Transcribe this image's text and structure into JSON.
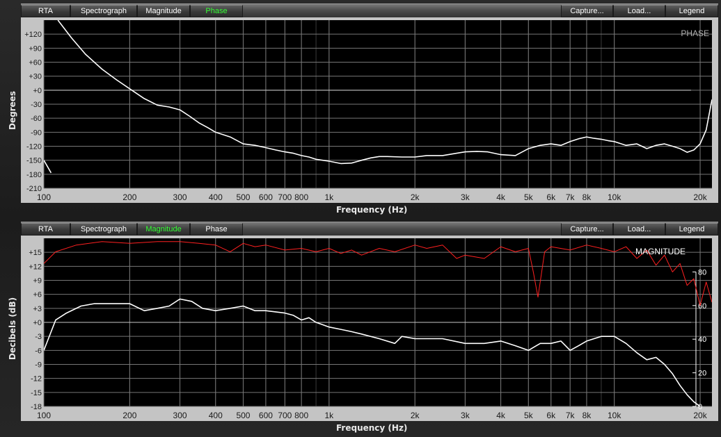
{
  "toolbar": {
    "tabs": [
      "RTA",
      "Spectrograph",
      "Magnitude",
      "Phase"
    ],
    "actions": [
      "Capture...",
      "Load...",
      "Legend"
    ]
  },
  "phase_panel": {
    "active_tab": "Phase"
  },
  "magnitude_panel": {
    "active_tab": "Magnitude"
  },
  "colors": {
    "trace": "#ffffff",
    "coherence": "#ff2020",
    "active_tab": "#33ff33",
    "plot_bg": "#000000"
  },
  "chart_data": [
    {
      "type": "line",
      "plot_label": "PHASE",
      "xlabel": "Frequency (Hz)",
      "ylabel": "Degrees",
      "xscale": "log",
      "xlim": [
        100,
        22000
      ],
      "ylim": [
        -210,
        150
      ],
      "x_ticks": [
        100,
        200,
        300,
        400,
        500,
        600,
        700,
        800,
        1000,
        2000,
        3000,
        4000,
        5000,
        6000,
        7000,
        8000,
        10000,
        20000
      ],
      "x_tick_labels": [
        "100",
        "200",
        "300",
        "400",
        "500",
        "600",
        "700",
        "800",
        "1k",
        "2k",
        "3k",
        "4k",
        "5k",
        "6k",
        "7k",
        "8k",
        "10k",
        "20k"
      ],
      "y_ticks": [
        120,
        90,
        60,
        30,
        0,
        -30,
        -60,
        -90,
        -120,
        -150,
        -180,
        -210
      ],
      "y_tick_labels": [
        "+120",
        "+90",
        "+60",
        "+30",
        "+0",
        "-30",
        "-60",
        "-90",
        "-120",
        "-150",
        "-180",
        "-210"
      ],
      "grid": true,
      "series": [
        {
          "x": [
            100,
            106
          ],
          "y": [
            -150,
            -177
          ]
        },
        {
          "x": [
            112,
            125,
            140,
            160,
            180,
            200,
            225,
            250,
            275,
            300,
            325,
            350,
            375,
            400,
            450,
            500,
            550,
            600,
            650,
            700,
            750,
            800,
            850,
            900,
            950,
            1000,
            1100,
            1200,
            1300,
            1400,
            1500,
            1600,
            1800,
            2000,
            2200,
            2500,
            2800,
            3000,
            3300,
            3600,
            4000,
            4500,
            5000,
            5500,
            6000,
            6500,
            7000,
            7500,
            8000,
            8500,
            9000,
            9500,
            10000,
            11000,
            12000,
            13000,
            14000,
            15000,
            16000,
            17000,
            18000,
            19000,
            20000,
            21000,
            22000
          ],
          "y": [
            150,
            112,
            77,
            45,
            22,
            3,
            -18,
            -32,
            -36,
            -42,
            -56,
            -70,
            -80,
            -90,
            -100,
            -115,
            -118,
            -123,
            -128,
            -132,
            -135,
            -140,
            -143,
            -148,
            -150,
            -152,
            -157,
            -156,
            -150,
            -145,
            -142,
            -142,
            -143,
            -143,
            -140,
            -140,
            -135,
            -132,
            -131,
            -132,
            -138,
            -140,
            -125,
            -118,
            -115,
            -118,
            -110,
            -104,
            -100,
            -103,
            -105,
            -108,
            -110,
            -118,
            -115,
            -125,
            -118,
            -115,
            -120,
            -125,
            -133,
            -128,
            -115,
            -85,
            -20
          ]
        }
      ]
    },
    {
      "type": "line",
      "plot_label": "MAGNITUDE",
      "xlabel": "Frequency (Hz)",
      "ylabel": "Decibels (dB)",
      "xscale": "log",
      "xlim": [
        100,
        22000
      ],
      "ylim": [
        -18,
        18
      ],
      "y2lim": [
        0,
        100
      ],
      "x_ticks": [
        100,
        200,
        300,
        400,
        500,
        600,
        700,
        800,
        1000,
        2000,
        3000,
        4000,
        5000,
        6000,
        7000,
        8000,
        10000,
        20000
      ],
      "x_tick_labels": [
        "100",
        "200",
        "300",
        "400",
        "500",
        "600",
        "700",
        "800",
        "1k",
        "2k",
        "3k",
        "4k",
        "5k",
        "6k",
        "7k",
        "8k",
        "10k",
        "20k"
      ],
      "y_ticks": [
        15,
        12,
        9,
        6,
        3,
        0,
        -3,
        -6,
        -9,
        -12,
        -15,
        -18
      ],
      "y_tick_labels": [
        "+15",
        "+12",
        "+9",
        "+6",
        "+3",
        "+0",
        "-3",
        "-6",
        "-9",
        "-12",
        "-15",
        "-18"
      ],
      "y2_ticks": [
        0,
        20,
        40,
        60,
        80
      ],
      "y2_tick_labels": [
        "0",
        "20",
        "40",
        "60",
        "80"
      ],
      "grid": true,
      "series": [
        {
          "axis": "left",
          "x": [
            100,
            110,
            120,
            135,
            150,
            175,
            200,
            225,
            250,
            275,
            300,
            330,
            360,
            400,
            450,
            500,
            550,
            600,
            700,
            750,
            800,
            850,
            900,
            950,
            1000,
            1100,
            1200,
            1300,
            1500,
            1700,
            1800,
            2000,
            2500,
            3000,
            3500,
            4000,
            4500,
            5000,
            5500,
            6000,
            6500,
            7000,
            7500,
            8000,
            9000,
            10000,
            11000,
            12000,
            13000,
            14000,
            15000,
            16000,
            17000,
            18000,
            19000,
            20000
          ],
          "y": [
            -6,
            0.5,
            2,
            3.5,
            4,
            4,
            4,
            2.5,
            3,
            3.5,
            5,
            4.5,
            3,
            2.5,
            3,
            3.5,
            2.5,
            2.5,
            2,
            1.5,
            0.5,
            1,
            0,
            -0.5,
            -1,
            -1.5,
            -2,
            -2.5,
            -3.5,
            -4.5,
            -3,
            -3.5,
            -3.5,
            -4.5,
            -4.5,
            -4,
            -5,
            -6,
            -4.5,
            -4.5,
            -4,
            -6,
            -5,
            -4,
            -3,
            -3,
            -4.5,
            -6.5,
            -8,
            -7.5,
            -9,
            -11,
            -13.5,
            -15.5,
            -17,
            -18
          ]
        },
        {
          "axis": "right",
          "x": [
            100,
            110,
            130,
            160,
            200,
            250,
            300,
            350,
            400,
            450,
            500,
            550,
            600,
            700,
            800,
            900,
            1000,
            1100,
            1200,
            1300,
            1500,
            1700,
            2000,
            2200,
            2500,
            2800,
            3000,
            3500,
            4000,
            4500,
            5000,
            5200,
            5400,
            5700,
            6000,
            7000,
            8000,
            9000,
            10000,
            11000,
            12000,
            13000,
            14000,
            15000,
            16000,
            17000,
            18000,
            19000,
            20000,
            21000,
            22000
          ],
          "y": [
            85,
            92,
            96,
            98,
            97,
            98,
            98,
            97,
            96,
            92,
            97,
            95,
            96,
            93,
            94,
            92,
            94,
            91,
            93,
            90,
            94,
            92,
            96,
            94,
            96,
            88,
            90,
            88,
            95,
            92,
            94,
            80,
            65,
            92,
            95,
            93,
            96,
            94,
            92,
            95,
            88,
            93,
            84,
            90,
            80,
            85,
            72,
            76,
            60,
            74,
            62
          ]
        }
      ]
    }
  ]
}
